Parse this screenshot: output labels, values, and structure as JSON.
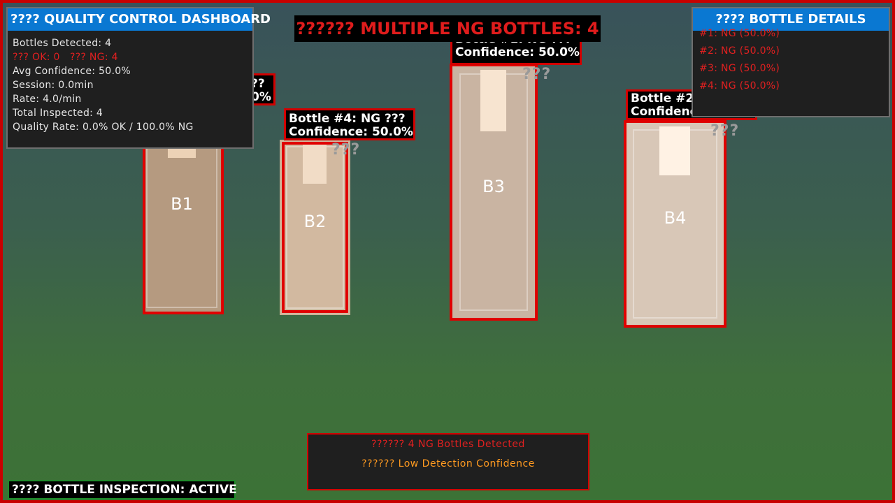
{
  "banner": "?????? MULTIPLE NG BOTTLES: 4",
  "dashboard": {
    "title": "???? QUALITY CONTROL DASHBOARD",
    "bottles_detected": "Bottles Detected: 4",
    "ok_ng": "??? OK: 0   ??? NG: 4",
    "avg_confidence": "Avg Confidence: 50.0%",
    "session": "Session: 0.0min",
    "rate": "Rate: 4.0/min",
    "total_inspected": "Total Inspected: 4",
    "quality_rate": "Quality Rate: 0.0% OK / 100.0% NG"
  },
  "details": {
    "title": "???? BOTTLE DETAILS",
    "items": [
      "#1: NG (50.0%)",
      "#2: NG (50.0%)",
      "#3: NG (50.0%)",
      "#4: NG (50.0%)"
    ]
  },
  "bottles": [
    {
      "label": "B1",
      "tag_line1": "??",
      "tag_line2": "0%",
      "marks": ""
    },
    {
      "label": "B2",
      "tag_line1": "Bottle #4: NG ???",
      "tag_line2": "Confidence: 50.0%",
      "marks": "???"
    },
    {
      "label": "B3",
      "tag_line1": "Bottle #1: NG ???",
      "tag_line2": "Confidence: 50.0%",
      "marks": "???"
    },
    {
      "label": "B4",
      "tag_line1": "Bottle #2",
      "tag_line2": "Confidence",
      "marks": "???"
    }
  ],
  "alerts": {
    "ng_alert": "?????? 4 NG Bottles Detected",
    "confidence_alert": "?????? Low Detection Confidence"
  },
  "status": "???? BOTTLE INSPECTION: ACTIVE",
  "colors": {
    "accent_blue": "#0a78d2",
    "ng_red": "#e00000",
    "warning_orange": "#ff9a20",
    "status_green": "#1f8a2a"
  }
}
